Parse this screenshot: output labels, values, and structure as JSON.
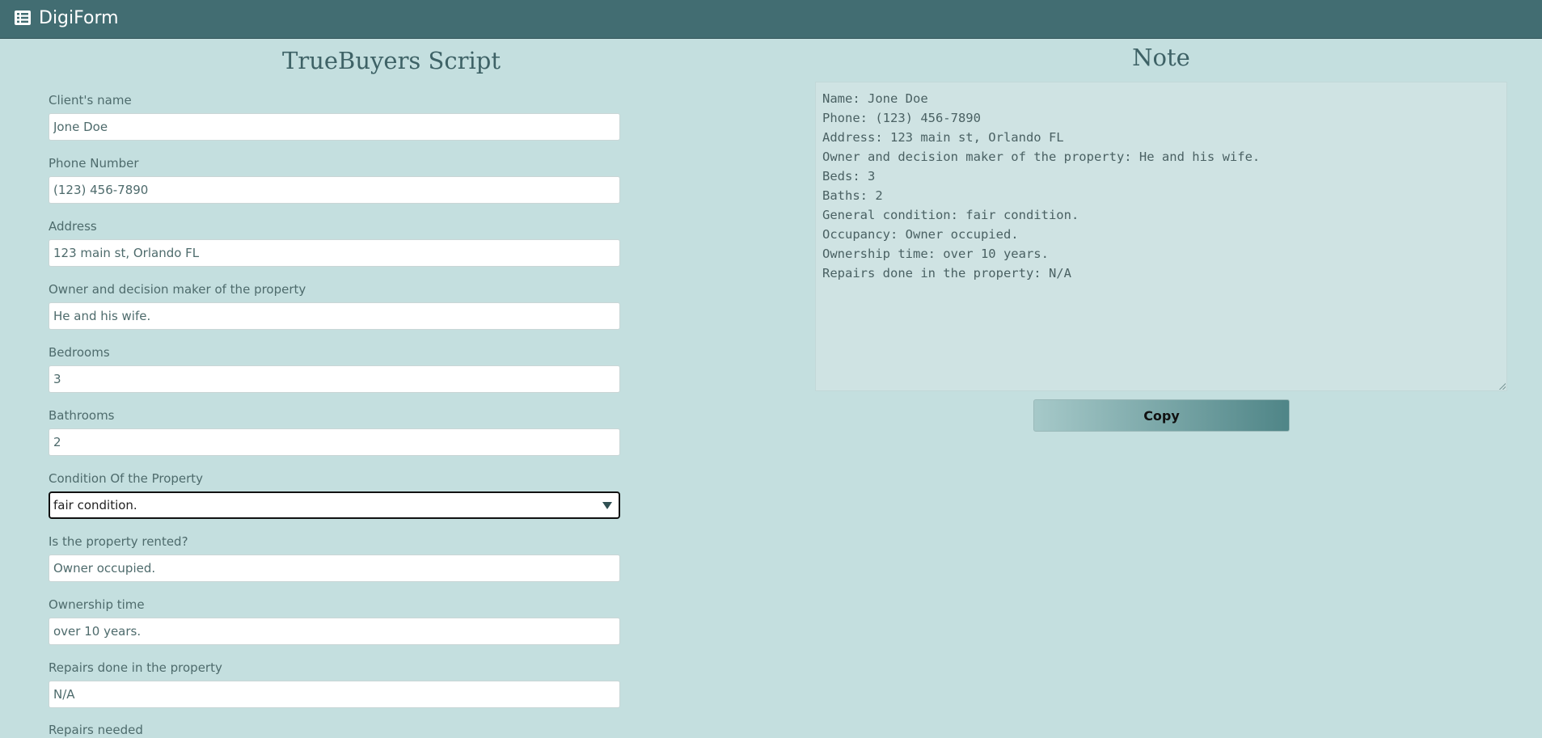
{
  "app": {
    "brand": "DigiForm",
    "brand_icon": "list-icon"
  },
  "form": {
    "title": "TrueBuyers Script",
    "fields": [
      {
        "label": "Client's name",
        "value": "Jone Doe"
      },
      {
        "label": "Phone Number",
        "value": "(123) 456-7890"
      },
      {
        "label": "Address",
        "value": "123 main st, Orlando FL"
      },
      {
        "label": "Owner and decision maker of the property",
        "value": "He and his wife."
      },
      {
        "label": "Bedrooms",
        "value": "3"
      },
      {
        "label": "Bathrooms",
        "value": "2"
      },
      {
        "label": "Condition Of the Property",
        "value": "fair condition."
      },
      {
        "label": "Is the property rented?",
        "value": "Owner occupied."
      },
      {
        "label": "Ownership time",
        "value": "over 10 years."
      },
      {
        "label": "Repairs done in the property",
        "value": "N/A"
      },
      {
        "label": "Repairs needed",
        "value": ""
      }
    ]
  },
  "note": {
    "title": "Note",
    "text": "Name: Jone Doe\nPhone: (123) 456-7890\nAddress: 123 main st, Orlando FL\nOwner and decision maker of the property: He and his wife.\nBeds: 3\nBaths: 2\nGeneral condition: fair condition.\nOccupancy: Owner occupied.\nOwnership time: over 10 years.\nRepairs done in the property: N/A",
    "copy_label": "Copy"
  },
  "colors": {
    "background": "#c4dfdf",
    "navbar": "#426d72",
    "text": "#3e6266"
  }
}
